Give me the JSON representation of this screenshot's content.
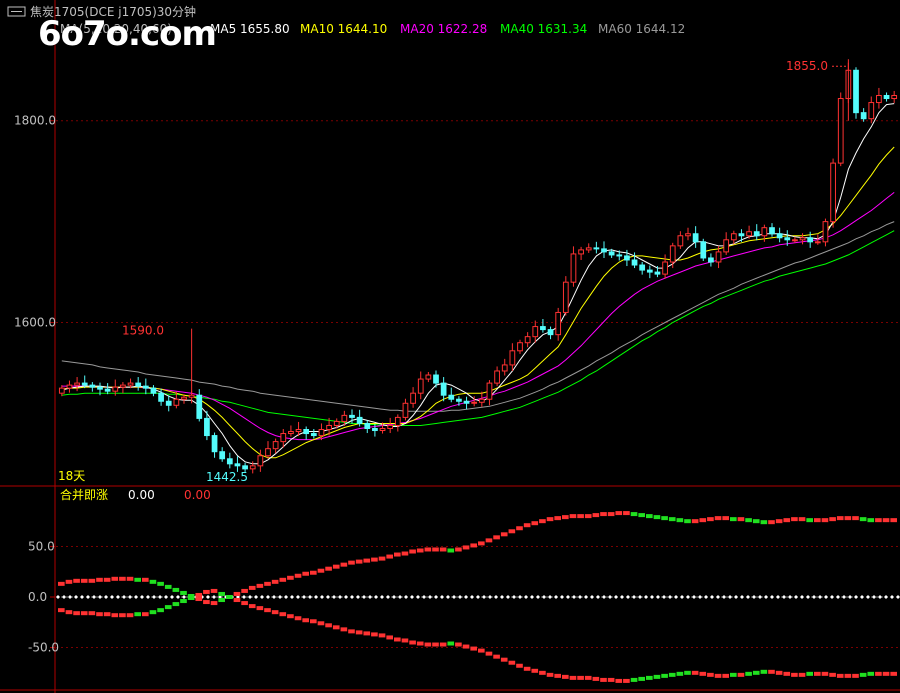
{
  "header": {
    "title": "焦炭1705(DCE j1705)30分钟",
    "ma_label": "MA(5,10,20,40,60)",
    "ma5": "MA5 1655.80",
    "ma10": "MA10 1644.10",
    "ma20": "MA20 1622.28",
    "ma40": "MA40 1631.34",
    "ma60": "MA60 1644.12"
  },
  "watermark": "6o7o.com",
  "colors": {
    "up": "#ff3232",
    "down": "#54fcfc",
    "ma5": "#ffffff",
    "ma10": "#ffff00",
    "ma20": "#ff00ff",
    "ma40": "#00ff00",
    "ma60": "#999999",
    "grid": "#7a0000",
    "axis": "#b00000",
    "text": "#c0c0c0"
  },
  "chart_data": [
    {
      "type": "candlestick",
      "title": "焦炭1705(DCE j1705)30分钟",
      "ylim": [
        1440,
        1880
      ],
      "yticks": [
        1800.0,
        1600.0
      ],
      "ytick_labels": [
        "1800.0",
        "1600.0"
      ],
      "period_label": "18天",
      "annotations": {
        "high": {
          "label": "1855.0",
          "value": 1855.0
        },
        "mid_high": {
          "label": "1590.0",
          "value": 1590.0
        },
        "low": {
          "label": "1442.5",
          "value": 1442.5
        }
      },
      "closes": [
        1535,
        1538,
        1540,
        1538,
        1536,
        1534,
        1532,
        1536,
        1538,
        1540,
        1537,
        1535,
        1530,
        1522,
        1518,
        1524,
        1526,
        1528,
        1505,
        1488,
        1472,
        1465,
        1460,
        1458,
        1455,
        1458,
        1468,
        1475,
        1482,
        1490,
        1492,
        1494,
        1490,
        1488,
        1494,
        1498,
        1502,
        1508,
        1506,
        1500,
        1495,
        1493,
        1495,
        1498,
        1506,
        1520,
        1530,
        1544,
        1548,
        1540,
        1528,
        1524,
        1522,
        1520,
        1521,
        1524,
        1540,
        1552,
        1558,
        1572,
        1580,
        1586,
        1596,
        1593,
        1588,
        1610,
        1640,
        1668,
        1672,
        1674,
        1673,
        1670,
        1667,
        1666,
        1662,
        1657,
        1652,
        1650,
        1648,
        1660,
        1676,
        1686,
        1688,
        1680,
        1664,
        1660,
        1670,
        1682,
        1688,
        1686,
        1690,
        1686,
        1694,
        1688,
        1684,
        1682,
        1682,
        1684,
        1680,
        1680,
        1700,
        1758,
        1822,
        1850,
        1808,
        1802,
        1818,
        1825,
        1822,
        1825
      ],
      "opens": [
        1530,
        1535,
        1538,
        1540,
        1538,
        1536,
        1534,
        1532,
        1536,
        1538,
        1540,
        1537,
        1535,
        1530,
        1522,
        1518,
        1524,
        1526,
        1528,
        1505,
        1488,
        1472,
        1465,
        1460,
        1458,
        1455,
        1458,
        1468,
        1475,
        1482,
        1490,
        1492,
        1494,
        1490,
        1488,
        1494,
        1498,
        1502,
        1508,
        1506,
        1500,
        1495,
        1493,
        1495,
        1498,
        1506,
        1520,
        1530,
        1544,
        1548,
        1540,
        1528,
        1524,
        1522,
        1520,
        1521,
        1524,
        1540,
        1552,
        1558,
        1572,
        1580,
        1586,
        1596,
        1593,
        1588,
        1610,
        1640,
        1668,
        1672,
        1674,
        1673,
        1670,
        1667,
        1666,
        1662,
        1657,
        1652,
        1650,
        1648,
        1660,
        1676,
        1686,
        1688,
        1680,
        1664,
        1660,
        1670,
        1682,
        1688,
        1686,
        1690,
        1686,
        1694,
        1688,
        1684,
        1682,
        1682,
        1684,
        1680,
        1680,
        1700,
        1758,
        1822,
        1850,
        1808,
        1802,
        1818,
        1825,
        1822
      ],
      "ma5": [
        1533,
        1535,
        1536,
        1537,
        1537,
        1537,
        1536,
        1535,
        1536,
        1536,
        1537,
        1536,
        1534,
        1531,
        1527,
        1524,
        1523,
        1523,
        1518,
        1510,
        1500,
        1490,
        1478,
        1468,
        1462,
        1460,
        1460,
        1464,
        1470,
        1477,
        1484,
        1489,
        1492,
        1492,
        1492,
        1494,
        1496,
        1499,
        1503,
        1505,
        1503,
        1501,
        1499,
        1497,
        1497,
        1500,
        1508,
        1518,
        1530,
        1538,
        1540,
        1538,
        1534,
        1530,
        1524,
        1522,
        1526,
        1534,
        1543,
        1552,
        1563,
        1573,
        1581,
        1588,
        1591,
        1596,
        1610,
        1626,
        1642,
        1656,
        1666,
        1671,
        1672,
        1670,
        1669,
        1666,
        1662,
        1658,
        1654,
        1654,
        1658,
        1665,
        1674,
        1680,
        1680,
        1678,
        1676,
        1676,
        1678,
        1682,
        1685,
        1686,
        1688,
        1688,
        1688,
        1687,
        1685,
        1684,
        1684,
        1683,
        1687,
        1700,
        1724,
        1752,
        1768,
        1782,
        1794,
        1808,
        1816,
        1817
      ],
      "ma10": [
        1534,
        1535,
        1535,
        1536,
        1536,
        1536,
        1536,
        1536,
        1536,
        1536,
        1536,
        1536,
        1535,
        1534,
        1532,
        1530,
        1528,
        1527,
        1524,
        1519,
        1513,
        1506,
        1498,
        1490,
        1482,
        1475,
        1469,
        1466,
        1466,
        1469,
        1473,
        1477,
        1481,
        1484,
        1487,
        1490,
        1493,
        1496,
        1498,
        1500,
        1500,
        1500,
        1500,
        1500,
        1500,
        1500,
        1503,
        1507,
        1513,
        1520,
        1524,
        1527,
        1529,
        1530,
        1530,
        1530,
        1532,
        1535,
        1538,
        1541,
        1544,
        1548,
        1555,
        1562,
        1569,
        1576,
        1588,
        1601,
        1614,
        1625,
        1636,
        1646,
        1654,
        1660,
        1664,
        1666,
        1666,
        1665,
        1664,
        1663,
        1662,
        1662,
        1664,
        1667,
        1670,
        1672,
        1673,
        1675,
        1677,
        1679,
        1681,
        1682,
        1683,
        1684,
        1685,
        1686,
        1686,
        1686,
        1687,
        1688,
        1692,
        1698,
        1706,
        1716,
        1726,
        1736,
        1746,
        1757,
        1766,
        1774
      ],
      "ma20": [
        1537,
        1537,
        1537,
        1537,
        1536,
        1536,
        1536,
        1536,
        1536,
        1536,
        1536,
        1535,
        1535,
        1534,
        1533,
        1532,
        1531,
        1530,
        1528,
        1526,
        1523,
        1519,
        1515,
        1510,
        1505,
        1500,
        1495,
        1491,
        1488,
        1486,
        1485,
        1484,
        1484,
        1484,
        1485,
        1487,
        1489,
        1491,
        1493,
        1495,
        1496,
        1497,
        1498,
        1499,
        1500,
        1501,
        1503,
        1505,
        1508,
        1511,
        1514,
        1517,
        1519,
        1521,
        1523,
        1525,
        1527,
        1530,
        1532,
        1535,
        1538,
        1541,
        1545,
        1549,
        1553,
        1557,
        1563,
        1570,
        1577,
        1585,
        1593,
        1601,
        1609,
        1616,
        1622,
        1628,
        1633,
        1637,
        1641,
        1644,
        1647,
        1650,
        1653,
        1656,
        1658,
        1660,
        1662,
        1664,
        1666,
        1668,
        1670,
        1672,
        1674,
        1675,
        1677,
        1678,
        1679,
        1680,
        1681,
        1682,
        1684,
        1687,
        1691,
        1696,
        1701,
        1706,
        1711,
        1717,
        1723,
        1729
      ],
      "ma40": [
        1528,
        1529,
        1529,
        1530,
        1530,
        1530,
        1530,
        1530,
        1530,
        1530,
        1530,
        1530,
        1530,
        1530,
        1529,
        1529,
        1528,
        1527,
        1526,
        1525,
        1524,
        1522,
        1521,
        1519,
        1517,
        1515,
        1513,
        1511,
        1510,
        1509,
        1508,
        1507,
        1506,
        1505,
        1504,
        1503,
        1502,
        1501,
        1500,
        1500,
        1499,
        1499,
        1498,
        1498,
        1498,
        1498,
        1498,
        1498,
        1499,
        1500,
        1501,
        1502,
        1503,
        1504,
        1505,
        1506,
        1508,
        1510,
        1512,
        1514,
        1516,
        1519,
        1522,
        1525,
        1528,
        1531,
        1535,
        1539,
        1543,
        1548,
        1552,
        1557,
        1562,
        1567,
        1572,
        1577,
        1582,
        1586,
        1591,
        1595,
        1600,
        1604,
        1608,
        1612,
        1616,
        1619,
        1623,
        1626,
        1629,
        1632,
        1635,
        1638,
        1641,
        1643,
        1646,
        1648,
        1650,
        1652,
        1654,
        1656,
        1658,
        1661,
        1664,
        1667,
        1671,
        1675,
        1679,
        1683,
        1687,
        1691
      ],
      "ma60": [
        1562,
        1561,
        1560,
        1559,
        1558,
        1556,
        1555,
        1554,
        1553,
        1552,
        1551,
        1549,
        1548,
        1547,
        1546,
        1545,
        1544,
        1543,
        1541,
        1540,
        1539,
        1537,
        1536,
        1534,
        1533,
        1532,
        1530,
        1529,
        1528,
        1527,
        1526,
        1525,
        1524,
        1523,
        1522,
        1521,
        1520,
        1519,
        1518,
        1517,
        1516,
        1515,
        1514,
        1513,
        1513,
        1512,
        1512,
        1512,
        1512,
        1512,
        1512,
        1513,
        1513,
        1514,
        1515,
        1516,
        1517,
        1519,
        1521,
        1523,
        1525,
        1528,
        1531,
        1534,
        1538,
        1541,
        1545,
        1549,
        1553,
        1557,
        1562,
        1566,
        1570,
        1575,
        1579,
        1583,
        1588,
        1592,
        1596,
        1600,
        1604,
        1608,
        1612,
        1616,
        1620,
        1624,
        1628,
        1631,
        1634,
        1638,
        1641,
        1644,
        1647,
        1650,
        1653,
        1656,
        1659,
        1661,
        1664,
        1667,
        1670,
        1673,
        1676,
        1679,
        1683,
        1686,
        1690,
        1693,
        1697,
        1700
      ]
    },
    {
      "type": "line",
      "title": "合并即涨",
      "legend": [
        "0.00",
        "0.00"
      ],
      "ylim": [
        -90,
        90
      ],
      "yticks": [
        50.0,
        0.0,
        -50.0
      ],
      "ytick_labels": [
        "50.0",
        "0.0",
        "-50.0"
      ],
      "series": [
        {
          "values": [
            13,
            15,
            16,
            16,
            16,
            17,
            17,
            18,
            18,
            18,
            17,
            17,
            15,
            13,
            10,
            7,
            4,
            1,
            -2,
            -5,
            -6,
            -3,
            0,
            3,
            6,
            9,
            11,
            13,
            15,
            17,
            19,
            21,
            23,
            24,
            26,
            28,
            30,
            32,
            34,
            35,
            36,
            37,
            38,
            40,
            42,
            43,
            45,
            46,
            47,
            47,
            47,
            46,
            47,
            49,
            51,
            53,
            56,
            59,
            62,
            65,
            68,
            71,
            73,
            75,
            77,
            78,
            79,
            80,
            80,
            80,
            81,
            82,
            82,
            83,
            83,
            82,
            81,
            80,
            79,
            78,
            77,
            76,
            75,
            75,
            76,
            77,
            78,
            78,
            77,
            77,
            76,
            75,
            74,
            74,
            75,
            76,
            77,
            77,
            76,
            76,
            76,
            77,
            78,
            78,
            78,
            77,
            76,
            76,
            76,
            76
          ]
        },
        {
          "values": [
            -13,
            -15,
            -16,
            -16,
            -16,
            -17,
            -17,
            -18,
            -18,
            -18,
            -17,
            -17,
            -15,
            -13,
            -10,
            -7,
            -4,
            -1,
            2,
            5,
            6,
            3,
            0,
            -3,
            -6,
            -9,
            -11,
            -13,
            -15,
            -17,
            -19,
            -21,
            -23,
            -24,
            -26,
            -28,
            -30,
            -32,
            -34,
            -35,
            -36,
            -37,
            -38,
            -40,
            -42,
            -43,
            -45,
            -46,
            -47,
            -47,
            -47,
            -46,
            -47,
            -49,
            -51,
            -53,
            -56,
            -59,
            -62,
            -65,
            -68,
            -71,
            -73,
            -75,
            -77,
            -78,
            -79,
            -80,
            -80,
            -80,
            -81,
            -82,
            -82,
            -83,
            -83,
            -82,
            -81,
            -80,
            -79,
            -78,
            -77,
            -76,
            -75,
            -75,
            -76,
            -77,
            -78,
            -78,
            -77,
            -77,
            -76,
            -75,
            -74,
            -74,
            -75,
            -76,
            -77,
            -77,
            -76,
            -76,
            -76,
            -77,
            -78,
            -78,
            -78,
            -77,
            -76,
            -76,
            -76,
            -76
          ]
        }
      ]
    }
  ]
}
